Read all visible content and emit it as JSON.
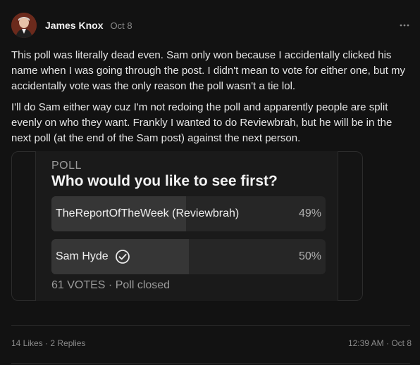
{
  "post": {
    "author": "James Knox",
    "date": "Oct 8",
    "paragraphs": [
      "This poll was literally dead even. Sam only won because I accidentally clicked his name when I was going through the post. I didn't mean to vote for either one, but my accidentally vote was the only reason the poll wasn't a tie lol.",
      "I'll do Sam either way cuz I'm not redoing the poll and apparently people are split evenly on who they want. Frankly I wanted to do Reviewbrah, but he will be in the next poll (at the end of the Sam post) against the next person."
    ]
  },
  "poll": {
    "label": "POLL",
    "question": "Who would you like to see first?",
    "options": [
      {
        "label": "TheReportOfTheWeek (Reviewbrah)",
        "percent_text": "49%",
        "fraction": 0.49,
        "voted": false
      },
      {
        "label": "Sam Hyde",
        "percent_text": "50%",
        "fraction": 0.5,
        "voted": true,
        "icon": "check-circle-icon"
      }
    ],
    "footer": "61 VOTES · Poll closed"
  },
  "footer": {
    "likes": "14 Likes",
    "separator": " · ",
    "replies": "2 Replies",
    "time": "12:39 AM",
    "time_separator": " · ",
    "date": "Oct 8"
  },
  "icons": {
    "more": "more-horizontal-icon",
    "avatar": "avatar"
  }
}
